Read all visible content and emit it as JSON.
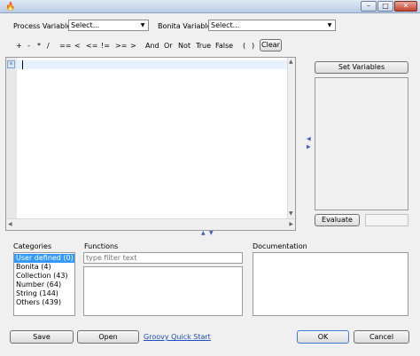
{
  "window": {
    "icons": {
      "app": "bonita-app-icon",
      "minimize": "minimize-icon",
      "maximize": "maximize-icon",
      "close": "close-icon"
    }
  },
  "toolbar": {
    "process_variables_label": "Process Variables",
    "process_variables_value": "Select...",
    "bonita_variables_label": "Bonita Variables",
    "bonita_variables_value": "Select...",
    "operators": [
      "+",
      "-",
      "*",
      "/",
      "==",
      "<",
      "<=",
      "!=",
      ">=",
      ">",
      "And",
      "Or",
      "Not",
      "True",
      "False",
      "(",
      ")"
    ],
    "clear_label": "Clear"
  },
  "right_panel": {
    "set_variables_label": "Set Variables",
    "evaluate_label": "Evaluate"
  },
  "categories": {
    "label": "Categories",
    "items": [
      "User defined (0)",
      "Bonita (4)",
      "Collection (43)",
      "Number (64)",
      "String (144)",
      "Others (439)"
    ],
    "selected_index": 0
  },
  "functions": {
    "label": "Functions",
    "filter_placeholder": "type filter text"
  },
  "documentation": {
    "label": "Documentation"
  },
  "footer": {
    "save_label": "Save",
    "open_label": "Open",
    "quick_start_label": "Groovy Quick Start",
    "ok_label": "OK",
    "cancel_label": "Cancel"
  },
  "colors": {
    "selection": "#3399ff",
    "link": "#1a4fc5",
    "current_line": "#e8f2fe"
  }
}
